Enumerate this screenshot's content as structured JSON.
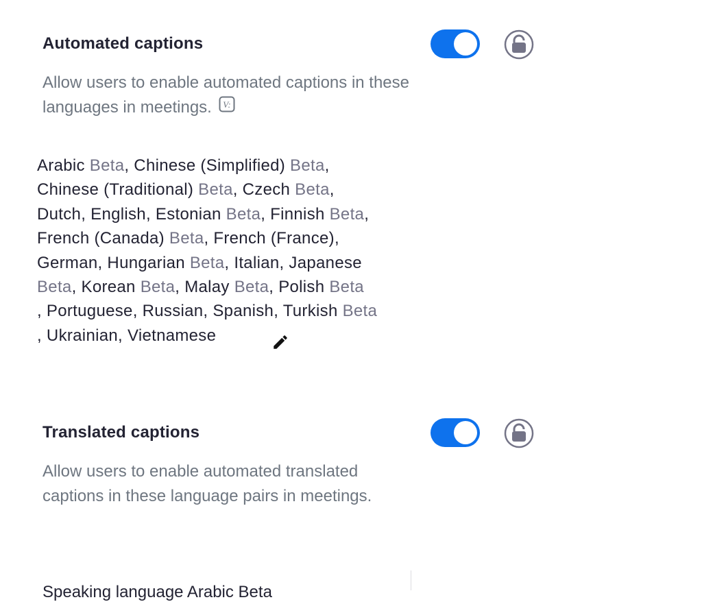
{
  "automated": {
    "title": "Automated captions",
    "description": "Allow users to enable automated captions in these languages in meetings.",
    "toggle_on": true,
    "languages_lines": [
      [
        {
          "t": " Arabic "
        },
        {
          "t": "Beta",
          "b": true
        },
        {
          "t": ", Chinese (Simplified) "
        },
        {
          "t": "Beta",
          "b": true
        },
        {
          "t": ","
        }
      ],
      [
        {
          "t": " Chinese (Traditional) "
        },
        {
          "t": "Beta",
          "b": true
        },
        {
          "t": ", Czech "
        },
        {
          "t": "Beta",
          "b": true
        },
        {
          "t": ","
        }
      ],
      [
        {
          "t": " Dutch, English, Estonian "
        },
        {
          "t": "Beta",
          "b": true
        },
        {
          "t": ", Finnish "
        },
        {
          "t": "Beta",
          "b": true
        },
        {
          "t": ","
        }
      ],
      [
        {
          "t": " French (Canada) "
        },
        {
          "t": "Beta",
          "b": true
        },
        {
          "t": ", French (France),"
        }
      ],
      [
        {
          "t": " German, Hungarian "
        },
        {
          "t": "Beta",
          "b": true
        },
        {
          "t": ", Italian, Japanese"
        }
      ],
      [
        {
          "t": "  "
        },
        {
          "t": "Beta",
          "b": true
        },
        {
          "t": ", Korean "
        },
        {
          "t": "Beta",
          "b": true
        },
        {
          "t": ", Malay "
        },
        {
          "t": "Beta",
          "b": true
        },
        {
          "t": ", Polish "
        },
        {
          "t": "Beta",
          "b": true
        }
      ],
      [
        {
          "t": ", Portuguese, Russian, Spanish, Turkish "
        },
        {
          "t": "Beta",
          "b": true
        }
      ],
      [
        {
          "t": ", Ukrainian, Vietnamese"
        }
      ]
    ]
  },
  "translated": {
    "title": "Translated captions",
    "description": "Allow users to enable automated translated captions in these language pairs in meetings.",
    "toggle_on": true,
    "partial_row": "Speaking language            Arabic Beta"
  },
  "colors": {
    "accent": "#0e72ed",
    "beta": "#747487",
    "muted": "#6e7680"
  },
  "icons": [
    "lock-icon",
    "v-badge-icon",
    "pencil-icon"
  ]
}
